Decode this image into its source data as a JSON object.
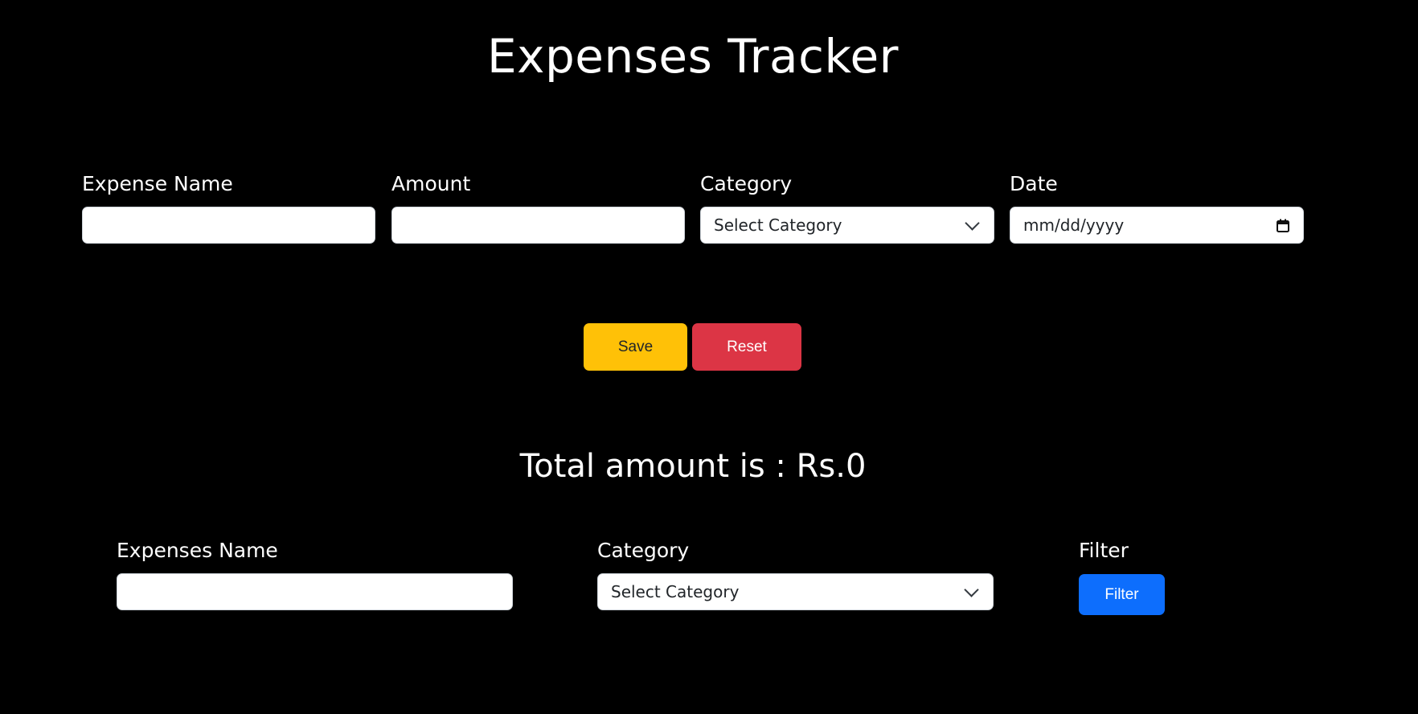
{
  "header": {
    "title": "Expenses Tracker"
  },
  "form": {
    "expense_name": {
      "label": "Expense Name",
      "value": ""
    },
    "amount": {
      "label": "Amount",
      "value": ""
    },
    "category": {
      "label": "Category",
      "selected": "Select Category"
    },
    "date": {
      "label": "Date",
      "placeholder": "mm/dd/yyyy"
    }
  },
  "actions": {
    "save_label": "Save",
    "reset_label": "Reset"
  },
  "summary": {
    "total_text": "Total amount is : Rs.0"
  },
  "filters": {
    "expenses_name": {
      "label": "Expenses Name",
      "value": ""
    },
    "category": {
      "label": "Category",
      "selected": "Select Category"
    },
    "filter": {
      "label": "Filter",
      "button_label": "Filter"
    }
  },
  "icons": {
    "dropdown": "chevron-down-icon",
    "date": "calendar-icon"
  },
  "colors": {
    "background": "#000000",
    "save": "#ffc107",
    "reset": "#dc3545",
    "filter": "#0d6efd"
  }
}
